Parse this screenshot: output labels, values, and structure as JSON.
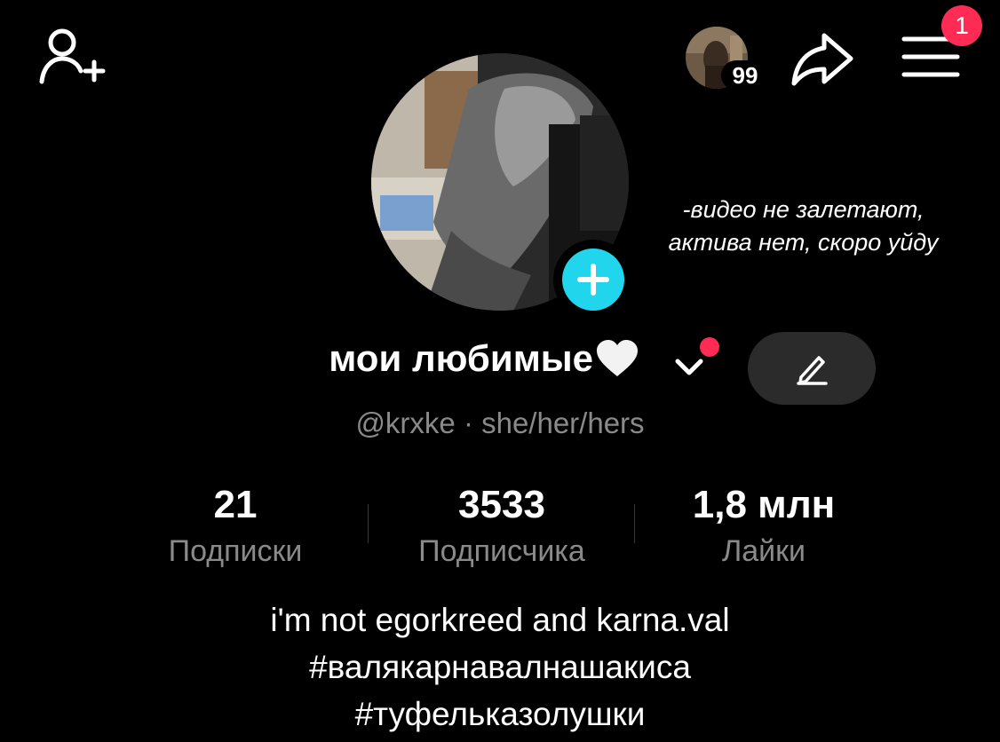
{
  "header": {
    "story_badge_count": "99",
    "menu_notification_count": "1"
  },
  "overlay_text_line1": "-видео не залетают,",
  "overlay_text_line2": "актива нет, скоро уйду",
  "profile": {
    "name": "мои любимые",
    "handle_line": "@krxke · she/her/hers",
    "stats": [
      {
        "value": "21",
        "label": "Подписки"
      },
      {
        "value": "3533",
        "label": "Подписчика"
      },
      {
        "value": "1,8 млн",
        "label": "Лайки"
      }
    ],
    "bio": [
      "i'm not egorkreed and karna.val",
      "#валякарнавалнашакиса",
      "#туфельказолушки"
    ]
  },
  "icons": {
    "add_friend": "add-person-icon",
    "share": "share-arrow-icon",
    "menu": "hamburger-menu-icon",
    "edit": "pencil-icon",
    "name_dropdown": "chevron-down-icon",
    "avatar_add": "plus-icon",
    "heart": "white-heart-icon"
  },
  "colors": {
    "background": "#000000",
    "accent_red": "#fe2c55",
    "accent_cyan": "#20d5ec",
    "secondary_text": "#8a8a8a",
    "edit_button_bg": "#2b2b2b"
  }
}
